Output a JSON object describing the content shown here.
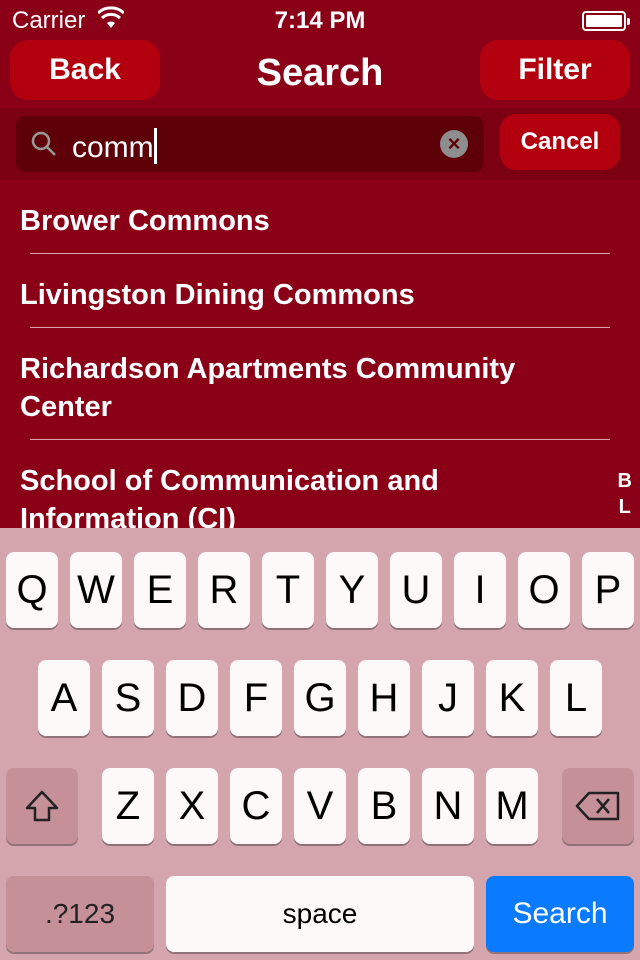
{
  "status": {
    "carrier": "Carrier",
    "time": "7:14 PM"
  },
  "nav": {
    "back": "Back",
    "title": "Search",
    "filter": "Filter"
  },
  "search": {
    "query": "comm",
    "cancel": "Cancel"
  },
  "results": [
    "Brower Commons",
    "Livingston Dining Commons",
    "Richardson Apartments Community Center",
    "School of Communication and Information (CI)"
  ],
  "index": [
    "B",
    "L"
  ],
  "keyboard": {
    "row1": [
      "Q",
      "W",
      "E",
      "R",
      "T",
      "Y",
      "U",
      "I",
      "O",
      "P"
    ],
    "row2": [
      "A",
      "S",
      "D",
      "F",
      "G",
      "H",
      "J",
      "K",
      "L"
    ],
    "row3": [
      "Z",
      "X",
      "C",
      "V",
      "B",
      "N",
      "M"
    ],
    "numbers": ".?123",
    "space": "space",
    "search": "Search"
  }
}
